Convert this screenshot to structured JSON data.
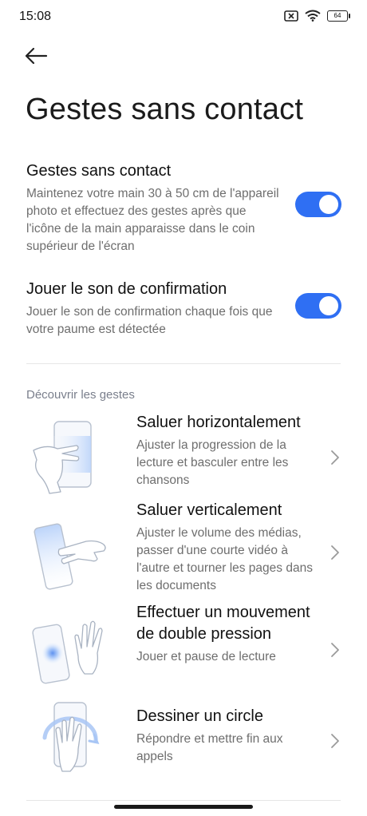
{
  "status_bar": {
    "time": "15:08",
    "battery": "64"
  },
  "page": {
    "title": "Gestes sans contact"
  },
  "settings": [
    {
      "title": "Gestes sans contact",
      "description": "Maintenez votre main 30 à 50 cm de l'appareil photo et effectuez des gestes après que l'icône de la main apparaisse dans le coin supérieur de l'écran",
      "enabled": true
    },
    {
      "title": "Jouer le son de confirmation",
      "description": "Jouer le son de confirmation chaque fois que votre paume est détectée",
      "enabled": true
    }
  ],
  "section": {
    "header": "Découvrir les gestes"
  },
  "gestures": [
    {
      "title": "Saluer horizontalement",
      "description": "Ajuster la progression de la lecture et basculer entre les chansons",
      "icon": "wave-horizontal-icon"
    },
    {
      "title": "Saluer verticalement",
      "description": "Ajuster le volume des médias, passer d'une courte vidéo à l'autre et tourner les pages dans les documents",
      "icon": "wave-vertical-icon"
    },
    {
      "title": "Effectuer un mouvement de double pression",
      "description": "Jouer et pause de lecture",
      "icon": "double-press-icon"
    },
    {
      "title": "Dessiner un circle",
      "description": "Répondre et mettre fin aux appels",
      "icon": "draw-circle-icon"
    }
  ],
  "colors": {
    "accent": "#2f6ff3",
    "secondary_text": "#6e6e6e",
    "section_header": "#7a7f8c",
    "illustration_blue": "#cfe0fb"
  }
}
